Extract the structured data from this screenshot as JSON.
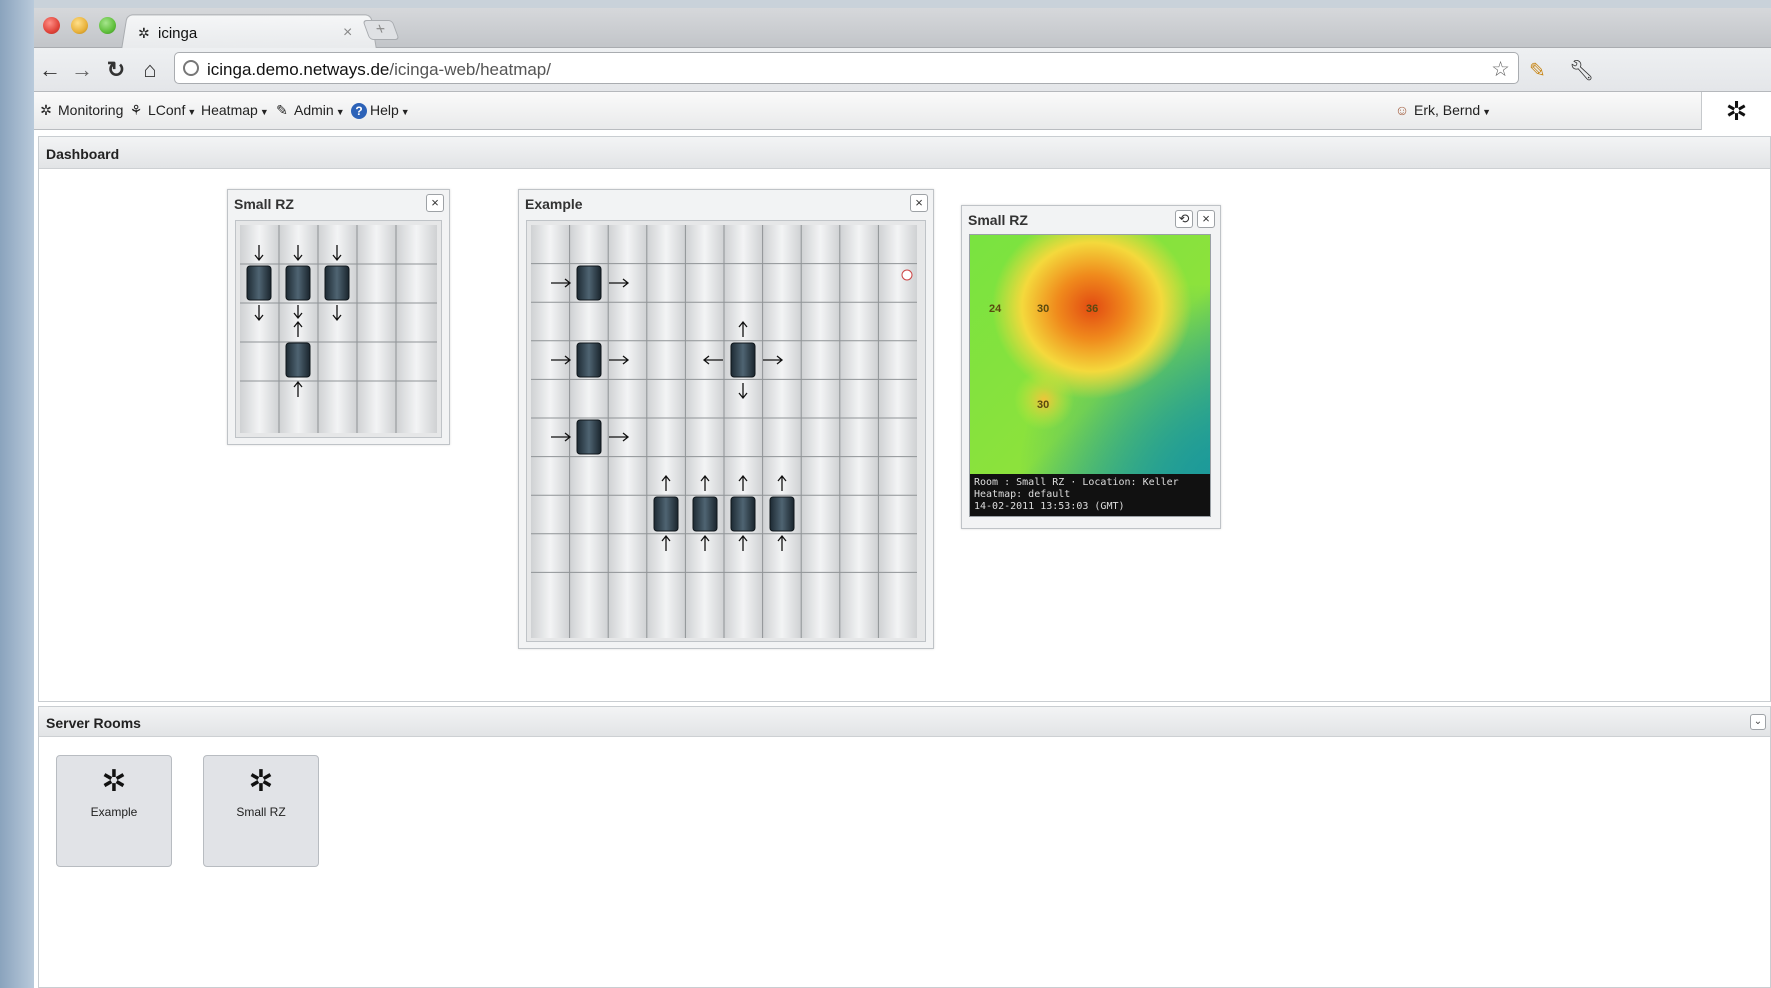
{
  "browser": {
    "tab_title": "icinga",
    "tab_icon": "icinga-logo-icon",
    "url_host": "icinga.demo.netways.de",
    "url_path": "/icinga-web/heatmap/"
  },
  "menu": {
    "items": [
      {
        "label": "Monitoring",
        "icon": "icinga-icon"
      },
      {
        "label": "LConf",
        "icon": "lconf-icon"
      },
      {
        "label": "Heatmap",
        "icon": ""
      },
      {
        "label": "Admin",
        "icon": "wrench-icon"
      },
      {
        "label": "Help",
        "icon": "help-icon"
      }
    ],
    "user": "Erk, Bernd"
  },
  "dashboard": {
    "title": "Dashboard",
    "widgets": {
      "small_rz_map": {
        "title": "Small RZ"
      },
      "example_map": {
        "title": "Example"
      },
      "small_rz_heatmap": {
        "title": "Small RZ",
        "values": [
          "24",
          "30",
          "36",
          "30"
        ],
        "footer_line1": "Room : Small RZ · Location: Keller",
        "footer_line2": "Heatmap: default",
        "footer_line3": "14-02-2011 13:53:03 (GMT)"
      }
    }
  },
  "server_rooms": {
    "title": "Server Rooms",
    "rooms": [
      {
        "label": "Example"
      },
      {
        "label": "Small RZ"
      }
    ]
  },
  "colors": {
    "accent": "#2c62b8",
    "heat_hot": "#e8501c",
    "heat_warm": "#f5d13a",
    "heat_mid": "#7fe03a",
    "heat_cool": "#2aa88f"
  }
}
